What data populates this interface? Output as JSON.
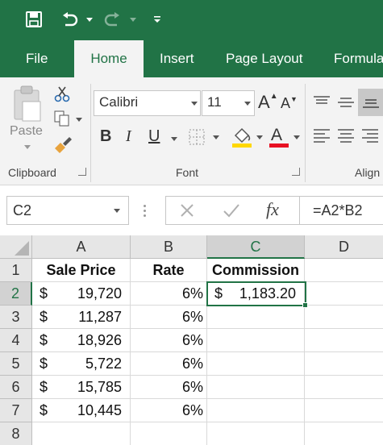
{
  "quick_access": {
    "save_icon": "save-icon",
    "undo_icon": "undo-icon",
    "redo_icon": "redo-icon",
    "customize_icon": "customize-quick-access-icon"
  },
  "tabs": [
    {
      "label": "File"
    },
    {
      "label": "Home"
    },
    {
      "label": "Insert"
    },
    {
      "label": "Page Layout"
    },
    {
      "label": "Formula"
    }
  ],
  "active_tab": "Home",
  "ribbon": {
    "clipboard": {
      "paste_label": "Paste",
      "group_label": "Clipboard"
    },
    "font": {
      "font_name": "Calibri",
      "font_size": "11",
      "group_label": "Font",
      "bold": "B",
      "italic": "I",
      "underline": "U",
      "grow": "A",
      "shrink": "A",
      "font_color_letter": "A"
    },
    "alignment": {
      "group_label": "Align"
    }
  },
  "formula_bar": {
    "name_box": "C2",
    "fx_label": "fx",
    "formula": "=A2*B2"
  },
  "grid": {
    "columns": [
      "A",
      "B",
      "C",
      "D"
    ],
    "selected_column": "C",
    "rows": [
      {
        "num": "1",
        "a_cur": "",
        "a": "Sale Price",
        "b": "Rate",
        "c_cur": "",
        "c": "Commission",
        "header": true
      },
      {
        "num": "2",
        "a_cur": "$",
        "a": "19,720",
        "b": "6%",
        "c_cur": "$",
        "c": "1,183.20"
      },
      {
        "num": "3",
        "a_cur": "$",
        "a": "11,287",
        "b": "6%",
        "c_cur": "",
        "c": ""
      },
      {
        "num": "4",
        "a_cur": "$",
        "a": "18,926",
        "b": "6%",
        "c_cur": "",
        "c": ""
      },
      {
        "num": "5",
        "a_cur": "$",
        "a": "5,722",
        "b": "6%",
        "c_cur": "",
        "c": ""
      },
      {
        "num": "6",
        "a_cur": "$",
        "a": "15,785",
        "b": "6%",
        "c_cur": "",
        "c": ""
      },
      {
        "num": "7",
        "a_cur": "$",
        "a": "10,445",
        "b": "6%",
        "c_cur": "",
        "c": ""
      },
      {
        "num": "8",
        "a_cur": "",
        "a": "",
        "b": "",
        "c_cur": "",
        "c": ""
      }
    ],
    "selected_row": "2",
    "selected_cell": "C2"
  },
  "colors": {
    "brand": "#217346",
    "ribbon": "#f3f3f3",
    "header": "#e6e6e6",
    "highlight_yellow": "#ffd800",
    "font_red": "#e81123"
  }
}
